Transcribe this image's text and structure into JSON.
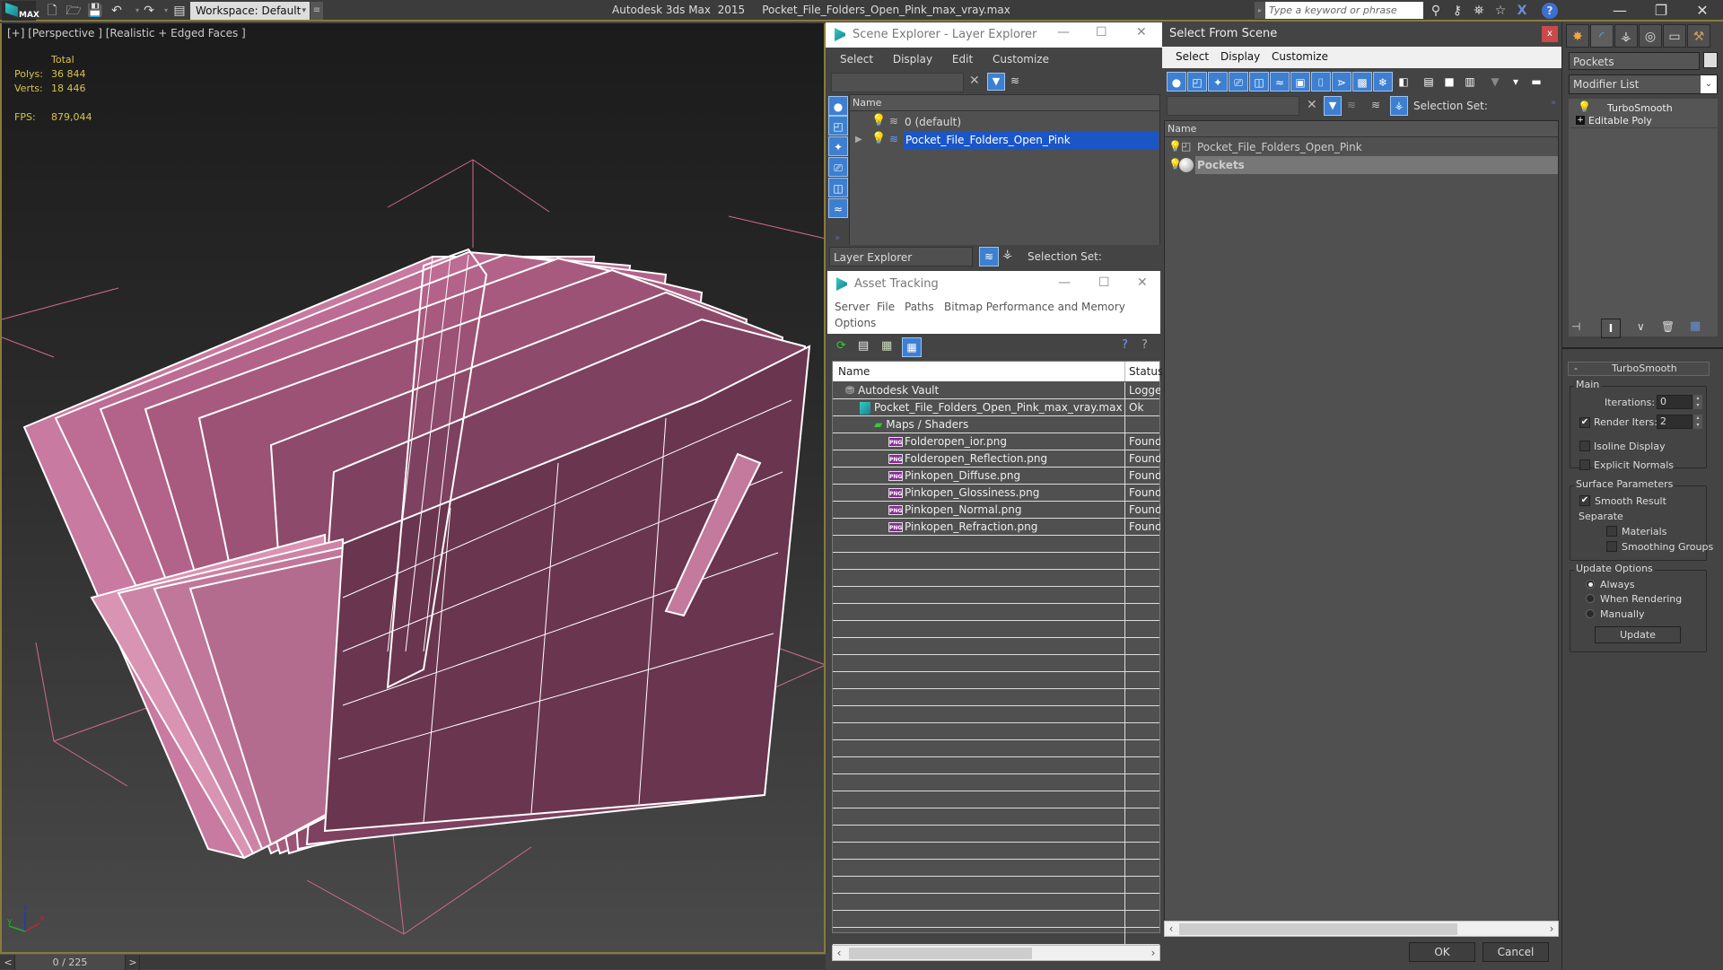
{
  "titlebar": {
    "app_logo": "MAX",
    "workspace": "Workspace: Default",
    "app_name": "Autodesk 3ds Max  2015",
    "file_name": "Pocket_File_Folders_Open_Pink_max_vray.max",
    "search_placeholder": "Type a keyword or phrase",
    "quick_access_icons": [
      "new-file-icon",
      "open-file-icon",
      "save-file-icon",
      "undo-icon",
      "redo-icon",
      "project-folder-icon"
    ],
    "info_center_icons": [
      "binoculars-icon",
      "key-icon",
      "satellite-icon",
      "star-icon",
      "exchange-icon",
      "help-icon"
    ],
    "window_controls": {
      "minimize": "—",
      "maximize": "❐",
      "close": "✕"
    }
  },
  "viewport": {
    "label": "[+] [Perspective ] [Realistic + Edged Faces ]",
    "stats": {
      "header": "Total",
      "polys_label": "Polys:",
      "polys_value": "36 844",
      "verts_label": "Verts:",
      "verts_value": "18 446",
      "fps_label": "FPS:",
      "fps_value": "879,044"
    },
    "axis": {
      "x": "x",
      "y": "y",
      "z": "z"
    },
    "model_color": "#c77a9d",
    "wire_color": "#ffffff"
  },
  "timeline": {
    "prev": "<",
    "frame": "0 / 225",
    "next": ">"
  },
  "scene_explorer": {
    "title": "Scene Explorer - Layer Explorer",
    "menu": [
      "Select",
      "Display",
      "Edit",
      "Customize"
    ],
    "column_name": "Name",
    "layers": [
      {
        "name": "0 (default)",
        "selected": false
      },
      {
        "name": "Pocket_File_Folders_Open_Pink",
        "selected": true
      }
    ],
    "footer": {
      "mode": "Layer Explorer",
      "selection_set_label": "Selection Set:"
    }
  },
  "asset_tracking": {
    "title": "Asset Tracking",
    "menu": [
      "Server",
      "File",
      "Paths",
      "Bitmap Performance and Memory",
      "Options"
    ],
    "columns": [
      "Name",
      "Status"
    ],
    "rows": [
      {
        "name": "Autodesk Vault",
        "status": "Logged",
        "level": 0,
        "icon": "vault-icon"
      },
      {
        "name": "Pocket_File_Folders_Open_Pink_max_vray.max",
        "status": "Ok",
        "level": 1,
        "icon": "max-file-icon"
      },
      {
        "name": "Maps / Shaders",
        "status": "",
        "level": 2,
        "icon": "maps-icon"
      },
      {
        "name": "Folderopen_ior.png",
        "status": "Found",
        "level": 3,
        "icon": "png-icon"
      },
      {
        "name": "Folderopen_Reflection.png",
        "status": "Found",
        "level": 3,
        "icon": "png-icon"
      },
      {
        "name": "Pinkopen_Diffuse.png",
        "status": "Found",
        "level": 3,
        "icon": "png-icon"
      },
      {
        "name": "Pinkopen_Glossiness.png",
        "status": "Found",
        "level": 3,
        "icon": "png-icon"
      },
      {
        "name": "Pinkopen_Normal.png",
        "status": "Found",
        "level": 3,
        "icon": "png-icon"
      },
      {
        "name": "Pinkopen_Refraction.png",
        "status": "Found",
        "level": 3,
        "icon": "png-icon"
      }
    ],
    "png_badge": "PNG"
  },
  "select_from_scene": {
    "title": "Select From Scene",
    "close": "x",
    "menu": [
      "Select",
      "Display",
      "Customize"
    ],
    "selection_set_label": "Selection Set:",
    "column_name": "Name",
    "items": [
      {
        "name": "Pocket_File_Folders_Open_Pink",
        "selected": false
      },
      {
        "name": "Pockets",
        "selected": true
      }
    ],
    "ok": "OK",
    "cancel": "Cancel"
  },
  "command_panel": {
    "object_name": "Pockets",
    "modifier_list": "Modifier List",
    "stack": [
      "TurboSmooth",
      "Editable Poly"
    ],
    "rollout_title": "TurboSmooth",
    "rollout_toggle": "-",
    "main_group": "Main",
    "iterations_label": "Iterations:",
    "iterations_value": "0",
    "render_iters_label": "Render Iters:",
    "render_iters_value": "2",
    "render_iters_checked": true,
    "isoline_label": "Isoline Display",
    "isoline_checked": false,
    "explicit_normals_label": "Explicit Normals",
    "explicit_normals_checked": false,
    "surface_group": "Surface Parameters",
    "smooth_result_label": "Smooth Result",
    "smooth_result_checked": true,
    "separate_label": "Separate",
    "materials_label": "Materials",
    "smoothing_groups_label": "Smoothing Groups",
    "update_group": "Update Options",
    "update_options": [
      "Always",
      "When Rendering",
      "Manually"
    ],
    "update_selected": "Always",
    "update_button": "Update"
  }
}
